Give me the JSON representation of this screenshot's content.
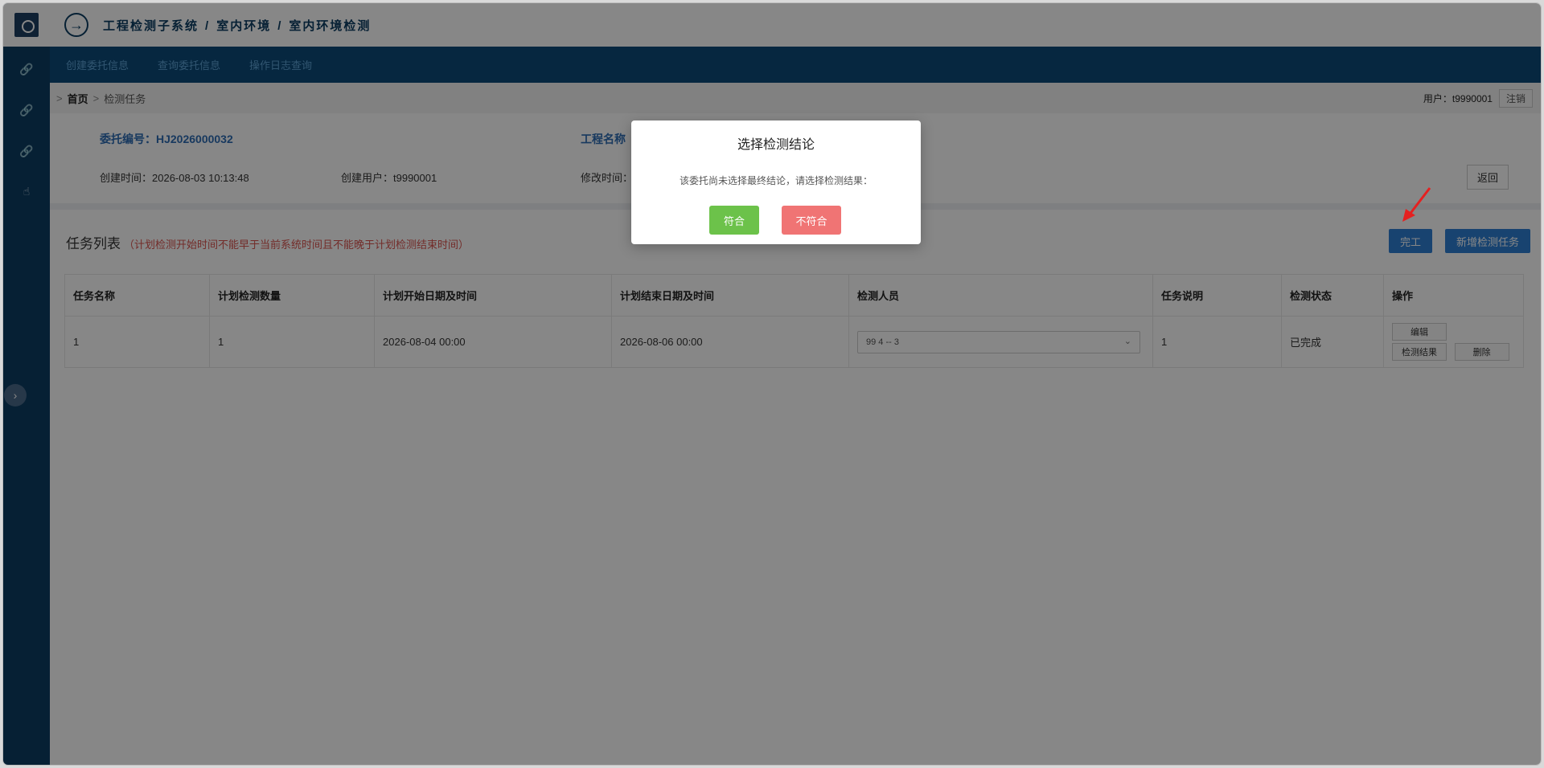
{
  "header": {
    "path": [
      "工程检测子系统",
      "室内环境",
      "室内环境检测"
    ],
    "separator": "/"
  },
  "nav": {
    "items": [
      "创建委托信息",
      "查询委托信息",
      "操作日志查询"
    ]
  },
  "breadcrumb": {
    "arrow": ">",
    "home": "首页",
    "current": "检测任务"
  },
  "user": {
    "label": "用户：t9990001",
    "logout": "注销"
  },
  "info": {
    "code": "委托编号：HJ2026000032",
    "project": "工程名称",
    "created_time": "创建时间：2026-08-03 10:13:48",
    "created_user": "创建用户：t9990001",
    "modified_time": "修改时间：",
    "back": "返回"
  },
  "tasks": {
    "title": "任务列表",
    "note": "（计划检测开始时间不能早于当前系统时间且不能晚于计划检测结束时间）",
    "complete_btn": "完工",
    "add_btn": "新增检测任务",
    "columns": [
      "任务名称",
      "计划检测数量",
      "计划开始日期及时间",
      "计划结束日期及时间",
      "检测人员",
      "任务说明",
      "检测状态",
      "操作"
    ],
    "rows": [
      {
        "name": "1",
        "quantity": "1",
        "start": "2026-08-04 00:00",
        "end": "2026-08-06 00:00",
        "inspector": "99        4 -- 3",
        "desc": "1",
        "status": "已完成",
        "ops": {
          "edit": "编辑",
          "result": "检测结果",
          "delete": "删除"
        }
      }
    ]
  },
  "modal": {
    "title": "选择检测结论",
    "text": "该委托尚未选择最终结论，请选择检测结果：",
    "pass": "符合",
    "fail": "不符合",
    "pass_color": "#6cc24a",
    "fail_color": "#f07474"
  },
  "colors": {
    "sidebar": "#0d3d62",
    "navbar": "#0d4a7a",
    "primary": "#2f7fd4"
  },
  "icons": [
    "link-icon",
    "link-icon",
    "link-icon",
    "pointer-icon",
    "chevron-right-icon"
  ]
}
